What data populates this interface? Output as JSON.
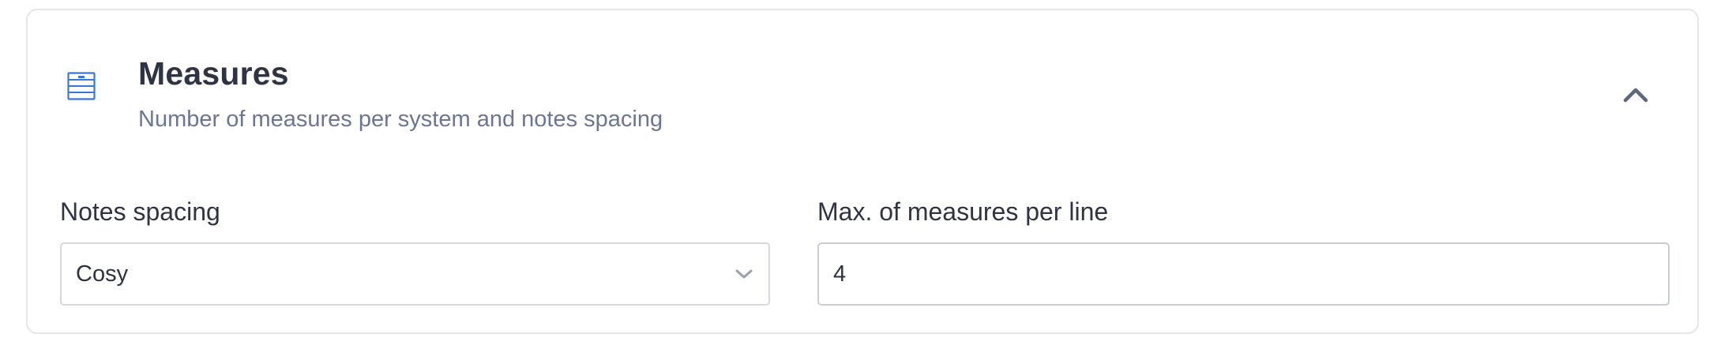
{
  "section": {
    "icon": "measures-staff-icon",
    "title": "Measures",
    "subtitle": "Number of measures per system and notes spacing",
    "collapse_icon": "chevron-up-icon"
  },
  "fields": {
    "notes_spacing": {
      "label": "Notes spacing",
      "value": "Cosy",
      "icon": "chevron-down-icon"
    },
    "max_measures": {
      "label": "Max. of measures per line",
      "value": "4"
    }
  },
  "colors": {
    "accent": "#3a78d8",
    "title": "#2f3445",
    "subtitle": "#6a7693",
    "border": "#e3e6ea"
  }
}
